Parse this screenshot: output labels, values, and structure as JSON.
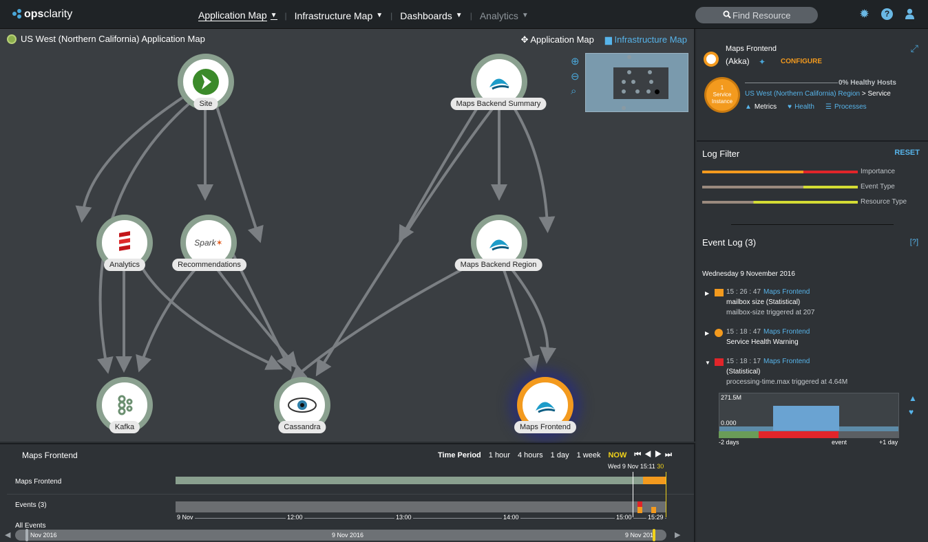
{
  "app": {
    "logo_bold": "ops",
    "logo_rest": "clarity"
  },
  "nav": {
    "items": [
      {
        "label": "Application Map"
      },
      {
        "label": "Infrastructure Map"
      },
      {
        "label": "Dashboards"
      },
      {
        "label": "Analytics"
      }
    ]
  },
  "search": {
    "placeholder": "Find Resource"
  },
  "map": {
    "title": "US West (Northern California) Application Map",
    "view_app": "Application Map",
    "view_infra": "Infrastructure Map",
    "nodes": {
      "site": "Site",
      "maps_backend_summary": "Maps Backend Summary",
      "analytics": "Analytics",
      "recommendations": "Recommendations",
      "maps_backend_region": "Maps Backend Region",
      "kafka": "Kafka",
      "cassandra": "Cassandra",
      "maps_frontend": "Maps Frontend"
    },
    "spark_text": "Spark"
  },
  "timeline": {
    "title": "Maps Frontend",
    "period_label": "Time Period",
    "periods": [
      "1 hour",
      "4 hours",
      "1 day",
      "1 week"
    ],
    "now": "NOW",
    "nav_controls": "⏮ ◀ ▶ ⏭",
    "stamp_date": "Wed 9 Nov 15:11",
    "stamp_yellow": "30",
    "row1": "Maps Frontend",
    "row2": "Events (3)",
    "row3": "All Events",
    "axis": [
      "9 Nov",
      "12:00",
      "13:00",
      "14:00",
      "15:00",
      "15:29"
    ],
    "scrub_left": "Nov 2016",
    "scrub_mid": "9 Nov 2016",
    "scrub_right": "9 Nov 201"
  },
  "resource": {
    "title": "Maps Frontend",
    "type": "(Akka)",
    "configure": "CONFIGURE",
    "service_count": "1",
    "service_word1": "Service",
    "service_word2": "Instance",
    "healthy": "0% Healthy Hosts",
    "region_link": "US West (Northern California) Region",
    "region_tail": " > Service",
    "links": [
      "Metrics",
      "Health",
      "Processes"
    ]
  },
  "log_filter": {
    "title": "Log Filter",
    "reset": "RESET",
    "sliders": [
      {
        "label": "Importance",
        "left_color": "#f39a1e",
        "right_color": "#e1252a",
        "split": 0.65
      },
      {
        "label": "Event Type",
        "left_color": "#9a8a7e",
        "right_color": "#d4dc34",
        "split": 0.65
      },
      {
        "label": "Resource Type",
        "left_color": "#9a8a7e",
        "right_color": "#d4dc34",
        "split": 0.33
      }
    ]
  },
  "event_log": {
    "title": "Event Log (3)",
    "help": "[?]",
    "date": "Wednesday 9 November 2016",
    "events": [
      {
        "time": "15 : 26 : 47",
        "source": "Maps Frontend",
        "line1": "mailbox size (Statistical)",
        "line2": "mailbox-size triggered at 207",
        "color": "#f39a1e"
      },
      {
        "time": "15 : 18 : 47",
        "source": "Maps Frontend",
        "line1": "Service Health Warning",
        "line2": "",
        "color": "#f39a1e"
      },
      {
        "time": "15 : 18 : 17",
        "source": "Maps Frontend",
        "line1": "(Statistical)",
        "line2": "processing-time.max triggered at 4.64M",
        "color": "#e1252a"
      }
    ],
    "chart": {
      "max": "271.5M",
      "min": "0.000",
      "left": "-2 days",
      "mid": "event",
      "right": "+1 day"
    }
  }
}
